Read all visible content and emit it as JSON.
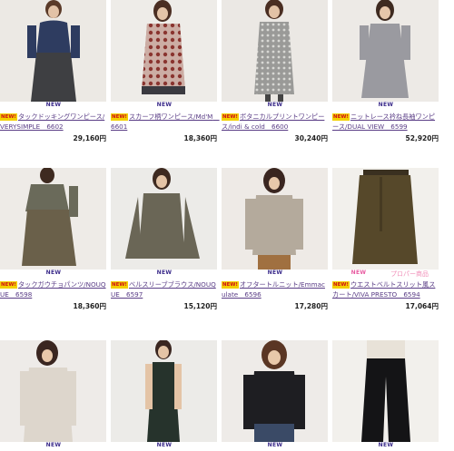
{
  "rows": [
    [
      {
        "tag": "NEW",
        "title": "タックドッキングワンピース/VERYSIMPLE　6602",
        "price": "29,160円",
        "photo": "navy-dress"
      },
      {
        "tag": "NEW",
        "title": "スカーフ柄ワンピース/Md'M　6601",
        "price": "18,360円",
        "photo": "scarf-dress"
      },
      {
        "tag": "NEW",
        "title": "ボタニカルプリントワンピース/indi & cold　6600",
        "price": "30,240円",
        "photo": "botanical-dress"
      },
      {
        "tag": "NEW",
        "title": "ニットレース衿ね長袖ワンピース/DUAL VIEW　6599",
        "price": "52,920円",
        "photo": "knit-dress"
      }
    ],
    [
      {
        "tag": "NEW",
        "title": "タックガウチョパンツ/NOUQUE　6598",
        "price": "18,360円",
        "photo": "gaucho"
      },
      {
        "tag": "NEW",
        "title": "ベルスリーブブラウス/NOUQUE　6597",
        "price": "15,120円",
        "photo": "bell-blouse"
      },
      {
        "tag": "NEW",
        "title": "オフタートルニット/Emmaculate　6596",
        "price": "17,280円",
        "photo": "turtle-knit"
      },
      {
        "tag": "NEW",
        "title": "ウエストベルトスリット風スカート/VIVA PRESTO　6594",
        "price": "17,064円",
        "photo": "belt-skirt",
        "promo": "プロパー商品"
      }
    ],
    [
      {
        "tag": "NEW",
        "title": "",
        "price": "",
        "photo": "white-shirt"
      },
      {
        "tag": "NEW",
        "title": "",
        "price": "",
        "photo": "green-dress"
      },
      {
        "tag": "NEW",
        "title": "",
        "price": "",
        "photo": "black-top"
      },
      {
        "tag": "NEW",
        "title": "",
        "price": "",
        "photo": "black-pants"
      }
    ]
  ],
  "new_badge": "NEW!",
  "colors": {
    "title": "#5a3d86",
    "new": "#3a2a8a",
    "badge_bg": "#f3d000",
    "badge_fg": "#d0101a",
    "promo": "#f08fb8"
  }
}
